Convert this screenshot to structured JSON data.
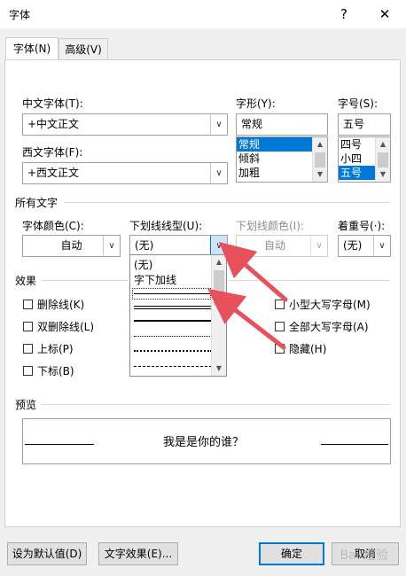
{
  "window": {
    "title": "字体",
    "help": "?",
    "close": "✕"
  },
  "tabs": [
    {
      "label": "字体(N)",
      "active": true
    },
    {
      "label": "高级(V)",
      "active": false
    }
  ],
  "chinese_font": {
    "label": "中文字体(T):",
    "value": "+中文正文"
  },
  "western_font": {
    "label": "西文字体(F):",
    "value": "+西文正文"
  },
  "style": {
    "label": "字形(Y):",
    "value": "常规",
    "options": [
      "常规",
      "倾斜",
      "加粗"
    ],
    "selected": "常规"
  },
  "size": {
    "label": "字号(S):",
    "value": "五号",
    "options": [
      "四号",
      "小四",
      "五号"
    ],
    "selected": "五号"
  },
  "all_text": {
    "section": "所有文字",
    "font_color": {
      "label": "字体颜色(C):",
      "value": "自动"
    },
    "underline_style": {
      "label": "下划线线型(U):",
      "value": "(无)"
    },
    "underline_color": {
      "label": "下划线颜色(I):",
      "value": "自动"
    },
    "emphasis": {
      "label": "着重号(·):",
      "value": "(无)"
    }
  },
  "underline_dropdown": {
    "items": [
      "(无)",
      "字下加线"
    ]
  },
  "effects": {
    "section": "效果",
    "left": [
      "删除线(K)",
      "双删除线(L)",
      "上标(P)",
      "下标(B)"
    ],
    "right": [
      "小型大写字母(M)",
      "全部大写字母(A)",
      "隐藏(H)"
    ]
  },
  "preview": {
    "section": "预览",
    "text": "我是是你的谁？"
  },
  "buttons": {
    "set_default": "设为默认值(D)",
    "text_effects": "文字效果(E)...",
    "ok": "确定",
    "cancel": "取消"
  },
  "watermark": "Bai 经验",
  "colors": {
    "accent": "#0078d7",
    "arrow": "#e8505b"
  }
}
